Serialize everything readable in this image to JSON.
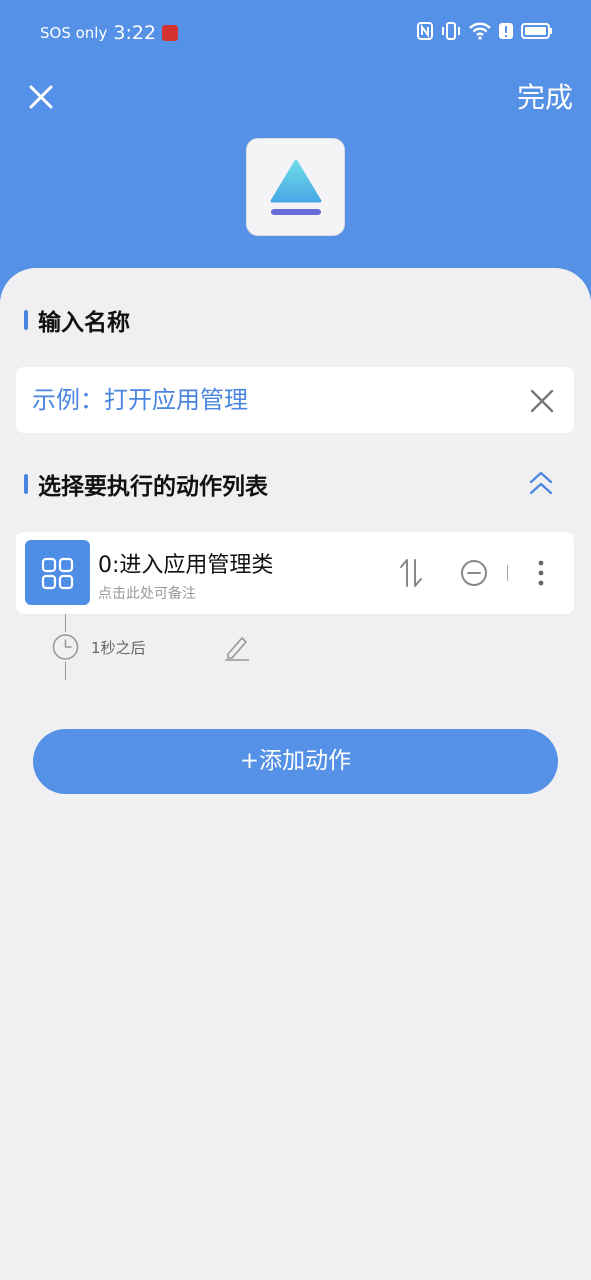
{
  "status_bar": {
    "sos_text": "SOS only",
    "time": "3:22"
  },
  "header": {
    "done_label": "完成",
    "close_icon": "close-icon",
    "app_icon": "eject-icon"
  },
  "name_section": {
    "title": "输入名称",
    "input_placeholder": "示例：打开应用管理"
  },
  "action_section": {
    "title": "选择要执行的动作列表",
    "actions": [
      {
        "title": "0:进入应用管理类",
        "note": "点击此处可备注",
        "delay": "1秒之后"
      }
    ]
  },
  "add_button": {
    "label": "+添加动作"
  },
  "colors": {
    "primary": "#5591e6",
    "accent": "#4a86e0",
    "background": "#f0f0f2"
  }
}
